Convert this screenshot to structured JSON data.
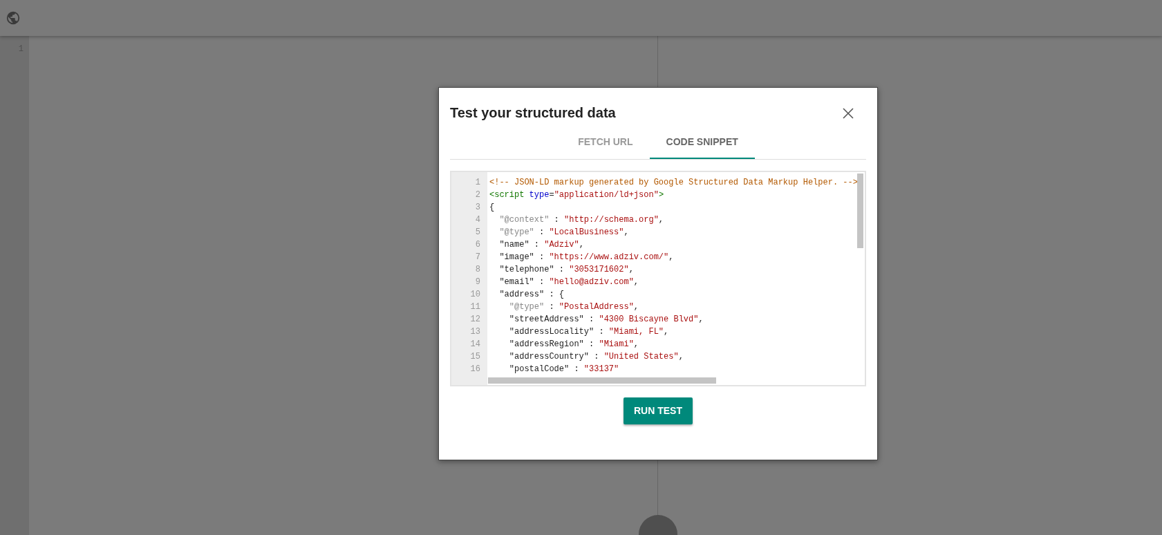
{
  "editor": {
    "line_numbers": [
      "1"
    ]
  },
  "dialog": {
    "title": "Test your structured data",
    "tabs": [
      {
        "label": "FETCH URL",
        "selected": false
      },
      {
        "label": "CODE SNIPPET",
        "selected": true
      }
    ],
    "code": [
      {
        "number": "1",
        "tokens": [
          {
            "text": "<!-- JSON-LD markup generated by Google Structured Data Markup Helper. -->",
            "kind": "comment"
          }
        ]
      },
      {
        "number": "2",
        "tokens": [
          {
            "text": "<script",
            "kind": "tag"
          },
          {
            "text": " type",
            "kind": "attr"
          },
          {
            "text": "=",
            "kind": "plain"
          },
          {
            "text": "\"application/ld+json\"",
            "kind": "string"
          },
          {
            "text": ">",
            "kind": "tag"
          }
        ]
      },
      {
        "number": "3",
        "tokens": [
          {
            "text": "{",
            "kind": "plain"
          }
        ]
      },
      {
        "number": "4",
        "tokens": [
          {
            "text": "  \"@context\"",
            "kind": "meta"
          },
          {
            "text": " : ",
            "kind": "plain"
          },
          {
            "text": "\"http://schema.org\"",
            "kind": "string"
          },
          {
            "text": ",",
            "kind": "plain"
          }
        ]
      },
      {
        "number": "5",
        "tokens": [
          {
            "text": "  \"@type\"",
            "kind": "meta"
          },
          {
            "text": " : ",
            "kind": "plain"
          },
          {
            "text": "\"LocalBusiness\"",
            "kind": "string"
          },
          {
            "text": ",",
            "kind": "plain"
          }
        ]
      },
      {
        "number": "6",
        "tokens": [
          {
            "text": "  \"name\" : ",
            "kind": "plain"
          },
          {
            "text": "\"Adziv\"",
            "kind": "string"
          },
          {
            "text": ",",
            "kind": "plain"
          }
        ]
      },
      {
        "number": "7",
        "tokens": [
          {
            "text": "  \"image\" : ",
            "kind": "plain"
          },
          {
            "text": "\"https://www.adziv.com/\"",
            "kind": "string"
          },
          {
            "text": ",",
            "kind": "plain"
          }
        ]
      },
      {
        "number": "8",
        "tokens": [
          {
            "text": "  \"telephone\" : ",
            "kind": "plain"
          },
          {
            "text": "\"3053171602\"",
            "kind": "string"
          },
          {
            "text": ",",
            "kind": "plain"
          }
        ]
      },
      {
        "number": "9",
        "tokens": [
          {
            "text": "  \"email\" : ",
            "kind": "plain"
          },
          {
            "text": "\"hello@adziv.com\"",
            "kind": "string"
          },
          {
            "text": ",",
            "kind": "plain"
          }
        ]
      },
      {
        "number": "10",
        "tokens": [
          {
            "text": "  \"address\" : {",
            "kind": "plain"
          }
        ]
      },
      {
        "number": "11",
        "tokens": [
          {
            "text": "    \"@type\"",
            "kind": "meta"
          },
          {
            "text": " : ",
            "kind": "plain"
          },
          {
            "text": "\"PostalAddress\"",
            "kind": "string"
          },
          {
            "text": ",",
            "kind": "plain"
          }
        ]
      },
      {
        "number": "12",
        "tokens": [
          {
            "text": "    \"streetAddress\" : ",
            "kind": "plain"
          },
          {
            "text": "\"4300 Biscayne Blvd\"",
            "kind": "string"
          },
          {
            "text": ",",
            "kind": "plain"
          }
        ]
      },
      {
        "number": "13",
        "tokens": [
          {
            "text": "    \"addressLocality\" : ",
            "kind": "plain"
          },
          {
            "text": "\"Miami, FL\"",
            "kind": "string"
          },
          {
            "text": ",",
            "kind": "plain"
          }
        ]
      },
      {
        "number": "14",
        "tokens": [
          {
            "text": "    \"addressRegion\" : ",
            "kind": "plain"
          },
          {
            "text": "\"Miami\"",
            "kind": "string"
          },
          {
            "text": ",",
            "kind": "plain"
          }
        ]
      },
      {
        "number": "15",
        "tokens": [
          {
            "text": "    \"addressCountry\" : ",
            "kind": "plain"
          },
          {
            "text": "\"United States\"",
            "kind": "string"
          },
          {
            "text": ",",
            "kind": "plain"
          }
        ]
      },
      {
        "number": "16",
        "tokens": [
          {
            "text": "    \"postalCode\" : ",
            "kind": "plain"
          },
          {
            "text": "\"33137\"",
            "kind": "string"
          }
        ]
      }
    ],
    "button": "RUN TEST"
  }
}
